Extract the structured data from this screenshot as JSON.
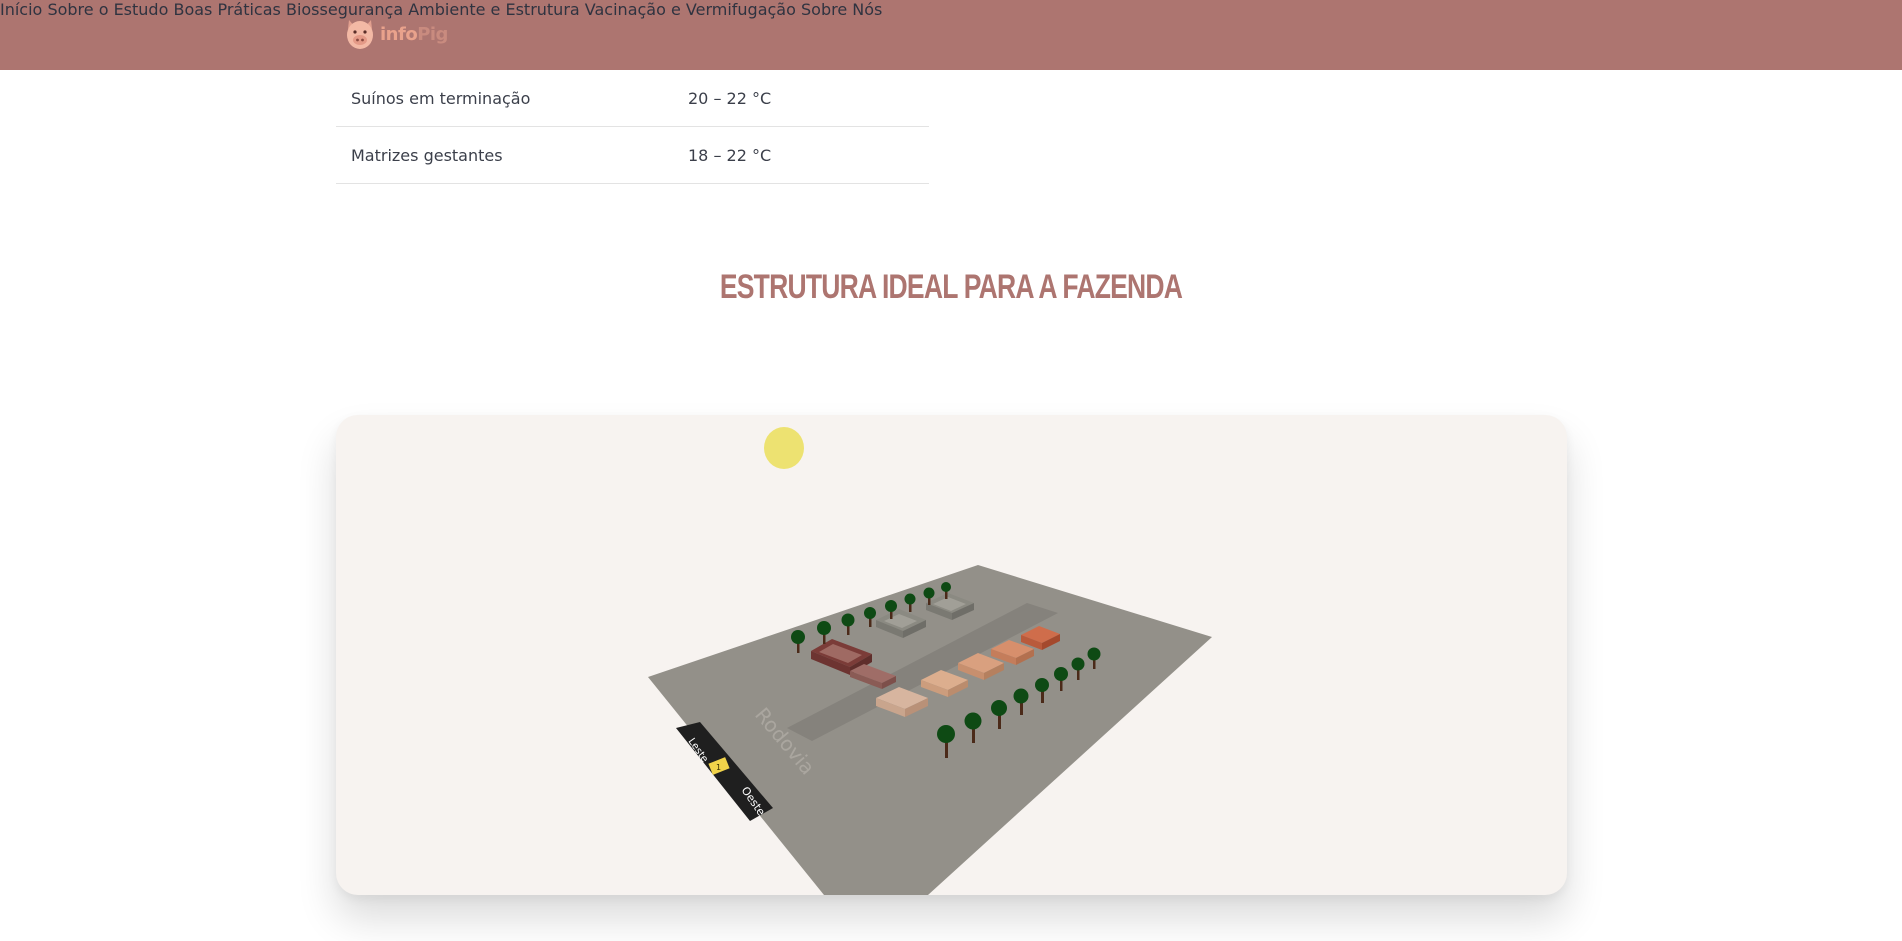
{
  "brand": {
    "name_part1": "info",
    "name_part2": "Pig"
  },
  "nav": {
    "items": [
      "Início",
      "Sobre o Estudo",
      "Boas Práticas",
      "Biossegurança",
      "Ambiente e Estrutura",
      "Vacinação e Vermifugação",
      "Sobre Nós"
    ]
  },
  "partial_text": "... , ... ... ... ... ... ... ... ... ... ...",
  "temperature_table": {
    "rows": [
      {
        "category": "Suínos em terminação",
        "range": "20 – 22 °C"
      },
      {
        "category": "Matrizes gestantes",
        "range": "18 – 22 °C"
      }
    ]
  },
  "section": {
    "title": "ESTRUTURA IDEAL PARA A FAZENDA"
  },
  "farm_model": {
    "road_label": "Rodovia",
    "direction_labels": {
      "east": "Leste",
      "west": "Oeste"
    },
    "sign_label": "1",
    "colors": {
      "ground": "#939089",
      "road_strip": "#85827c",
      "highway": "#1f1f1f",
      "sign": "#f1d34a",
      "sun": "#ede271",
      "tree_crown": "#0e4a14",
      "tree_trunk": "#4b2a19"
    }
  }
}
